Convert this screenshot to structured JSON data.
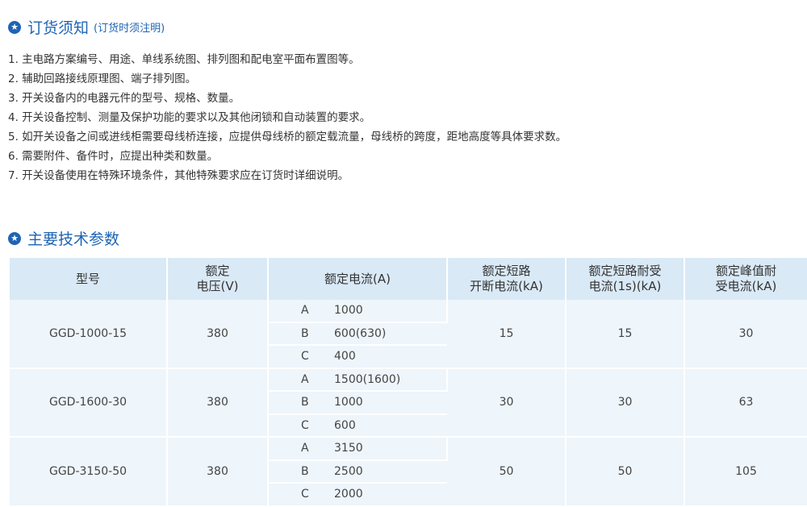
{
  "ordering": {
    "title": "订货须知",
    "subtitle": "(订货时须注明)",
    "items": [
      "1. 主电路方案编号、用途、单线系统图、排列图和配电室平面布置图等。",
      "2. 辅助回路接线原理图、端子排列图。",
      "3. 开关设备内的电器元件的型号、规格、数量。",
      "4. 开关设备控制、测量及保护功能的要求以及其他闭锁和自动装置的要求。",
      "5. 如开关设备之间或进线柜需要母线桥连接，应提供母线桥的额定载流量，母线桥的跨度，距地高度等具体要求数。",
      "6. 需要附件、备件时，应提出种类和数量。",
      "7. 开关设备使用在特殊环境条件，其他特殊要求应在订货时详细说明。"
    ]
  },
  "specs": {
    "title": "主要技术参数",
    "headers": {
      "model": "型号",
      "voltage_l1": "额定",
      "voltage_l2": "电压(V)",
      "current": "额定电流(A)",
      "breaking_l1": "额定短路",
      "breaking_l2": "开断电流(kA)",
      "withstand_l1": "额定短路耐受",
      "withstand_l2": "电流(1s)(kA)",
      "peak_l1": "额定峰值耐",
      "peak_l2": "受电流(kA)"
    },
    "rows": [
      {
        "model": "GGD-1000-15",
        "voltage": "380",
        "currents": [
          {
            "level": "A",
            "value": "1000"
          },
          {
            "level": "B",
            "value": "600(630)"
          },
          {
            "level": "C",
            "value": "400"
          }
        ],
        "breaking": "15",
        "withstand": "15",
        "peak": "30"
      },
      {
        "model": "GGD-1600-30",
        "voltage": "380",
        "currents": [
          {
            "level": "A",
            "value": "1500(1600)"
          },
          {
            "level": "B",
            "value": "1000"
          },
          {
            "level": "C",
            "value": "600"
          }
        ],
        "breaking": "30",
        "withstand": "30",
        "peak": "63"
      },
      {
        "model": "GGD-3150-50",
        "voltage": "380",
        "currents": [
          {
            "level": "A",
            "value": "3150"
          },
          {
            "level": "B",
            "value": "2500"
          },
          {
            "level": "C",
            "value": "2000"
          }
        ],
        "breaking": "50",
        "withstand": "50",
        "peak": "105"
      }
    ]
  },
  "colors": {
    "accent": "#1e64b4",
    "header_bg": "#d9e9f6",
    "cell_bg": "#eef5fb"
  },
  "icons": {
    "section_marker": "star-circle-icon"
  }
}
